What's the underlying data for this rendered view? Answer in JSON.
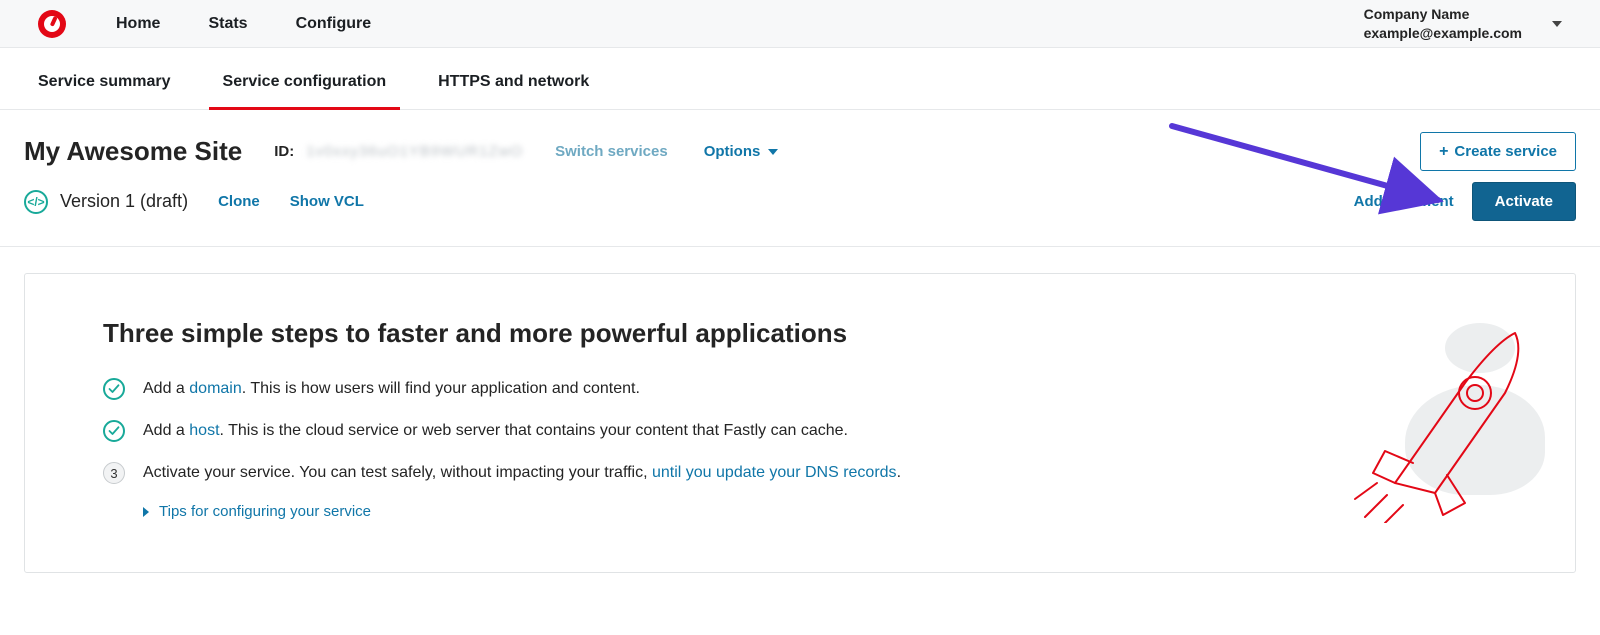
{
  "topnav": {
    "home": "Home",
    "stats": "Stats",
    "configure": "Configure"
  },
  "account": {
    "company": "Company Name",
    "email": "example@example.com"
  },
  "subnav": {
    "summary": "Service summary",
    "config": "Service configuration",
    "https": "HTTPS and network"
  },
  "service": {
    "title": "My Awesome Site",
    "id_label": "ID:",
    "id_value": "1v0xxy36uO1YB9WUR1ZwO",
    "switch": "Switch services",
    "options": "Options",
    "create": "Create service"
  },
  "version": {
    "label": "Version 1 (draft)",
    "clone": "Clone",
    "show_vcl": "Show VCL",
    "add_comment": "Add comment",
    "activate": "Activate"
  },
  "steps": {
    "heading": "Three simple steps to faster and more powerful applications",
    "s1_pre": "Add a ",
    "s1_link": "domain",
    "s1_post": ". This is how users will find your application and content.",
    "s2_pre": "Add a ",
    "s2_link": "host",
    "s2_post": ". This is the cloud service or web server that contains your content that Fastly can cache.",
    "s3_pre": "Activate your service. You can test safely, without impacting your traffic, ",
    "s3_link": "until you update your DNS records",
    "s3_post": ".",
    "s3_num": "3",
    "tips": "Tips for configuring your service"
  }
}
